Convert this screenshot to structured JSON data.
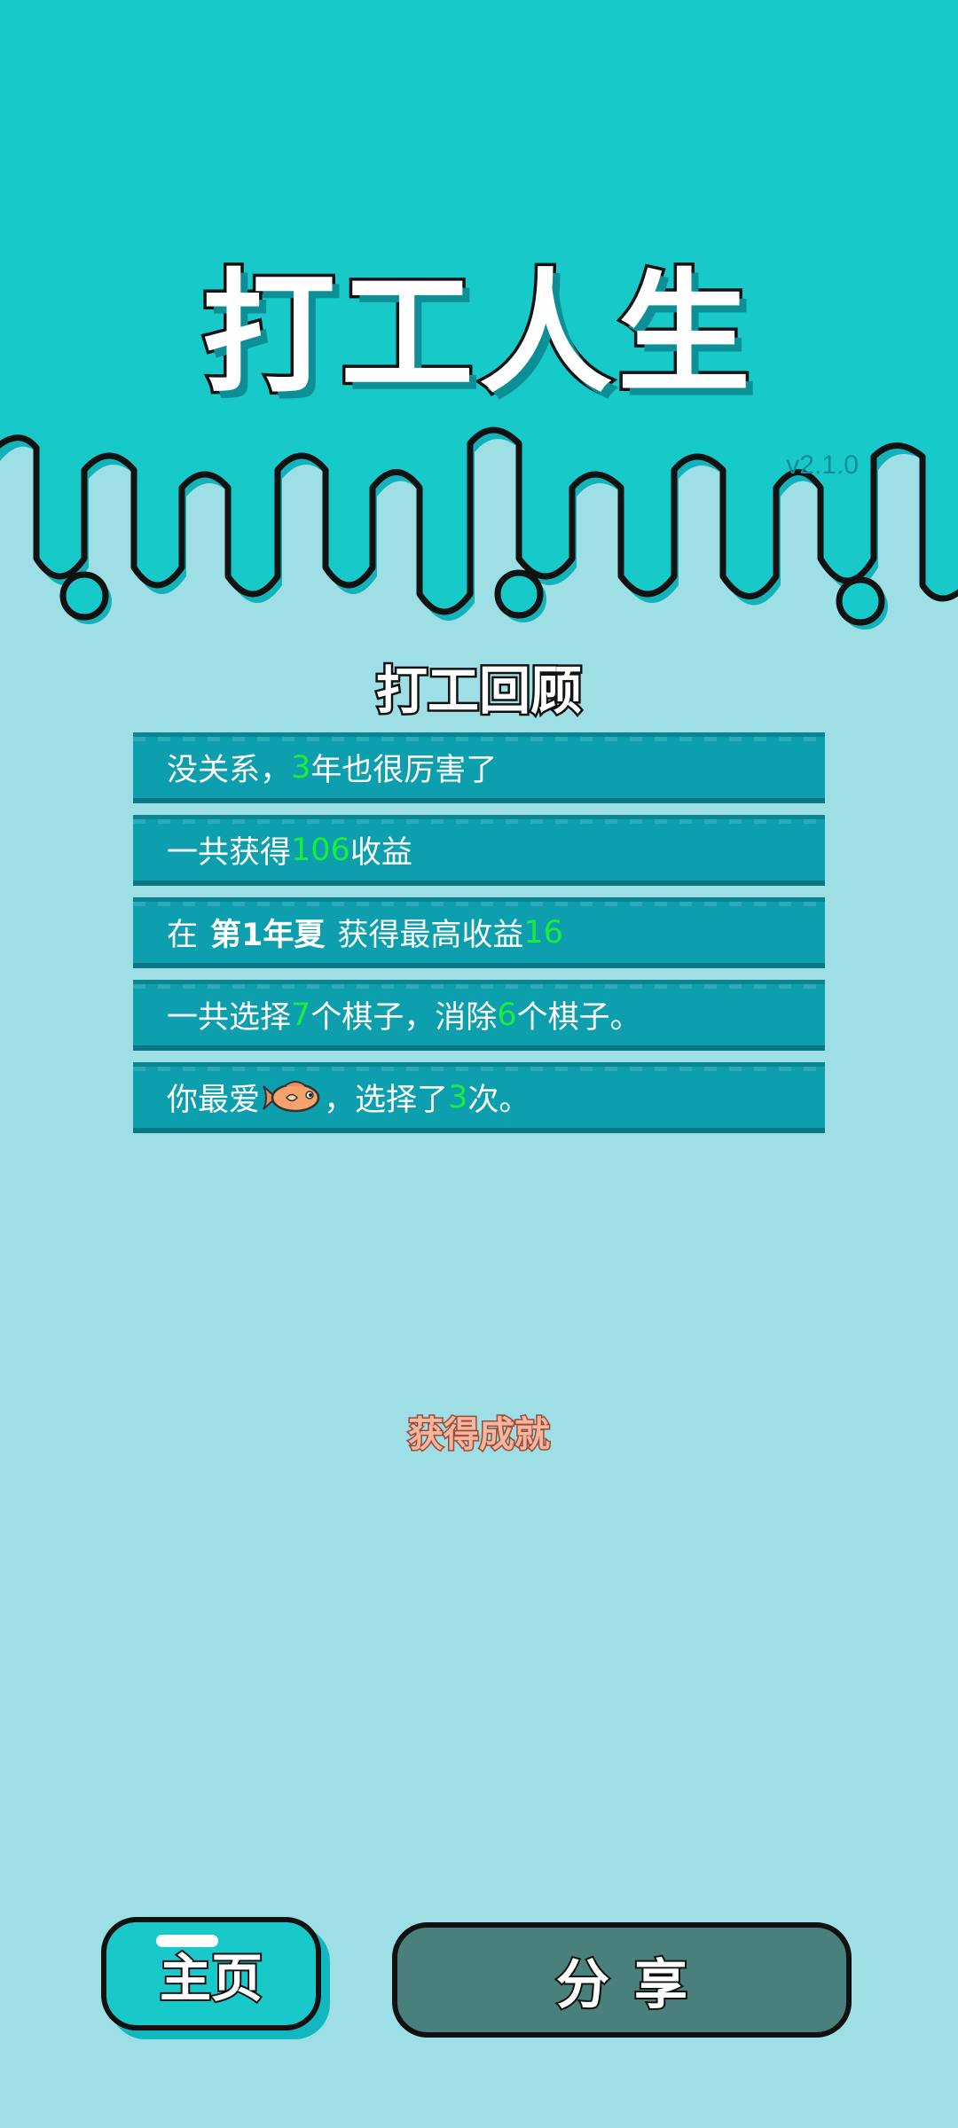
{
  "header": {
    "title": "打工人生",
    "version": "v2.1.0",
    "colors": {
      "top": "#17c9c9",
      "bottom": "#9ddfe5"
    }
  },
  "review": {
    "title": "打工回顾",
    "rows": [
      {
        "parts": [
          {
            "text": "没关系，",
            "style": "normal"
          },
          {
            "text": "3",
            "style": "num"
          },
          {
            "text": "年也很厉害了",
            "style": "normal"
          }
        ]
      },
      {
        "parts": [
          {
            "text": "一共获得",
            "style": "normal"
          },
          {
            "text": "106",
            "style": "num"
          },
          {
            "text": "收益",
            "style": "normal"
          }
        ]
      },
      {
        "parts": [
          {
            "text": "在",
            "style": "normal"
          },
          {
            "text": "第1年夏",
            "style": "bold"
          },
          {
            "text": "获得最高收益",
            "style": "normal"
          },
          {
            "text": "16",
            "style": "num"
          }
        ]
      },
      {
        "parts": [
          {
            "text": "一共选择",
            "style": "normal"
          },
          {
            "text": "7",
            "style": "num"
          },
          {
            "text": "个棋子，消除",
            "style": "normal"
          },
          {
            "text": "6",
            "style": "num"
          },
          {
            "text": "个棋子。",
            "style": "normal"
          }
        ]
      },
      {
        "parts": [
          {
            "text": "你最爱",
            "style": "normal"
          },
          {
            "icon": "fish-icon"
          },
          {
            "text": "，选择了",
            "style": "normal"
          },
          {
            "text": "3",
            "style": "num"
          },
          {
            "text": "次。",
            "style": "normal"
          }
        ]
      }
    ]
  },
  "achievement": {
    "label": "获得成就"
  },
  "buttons": {
    "home": "主页",
    "share": "分享"
  }
}
